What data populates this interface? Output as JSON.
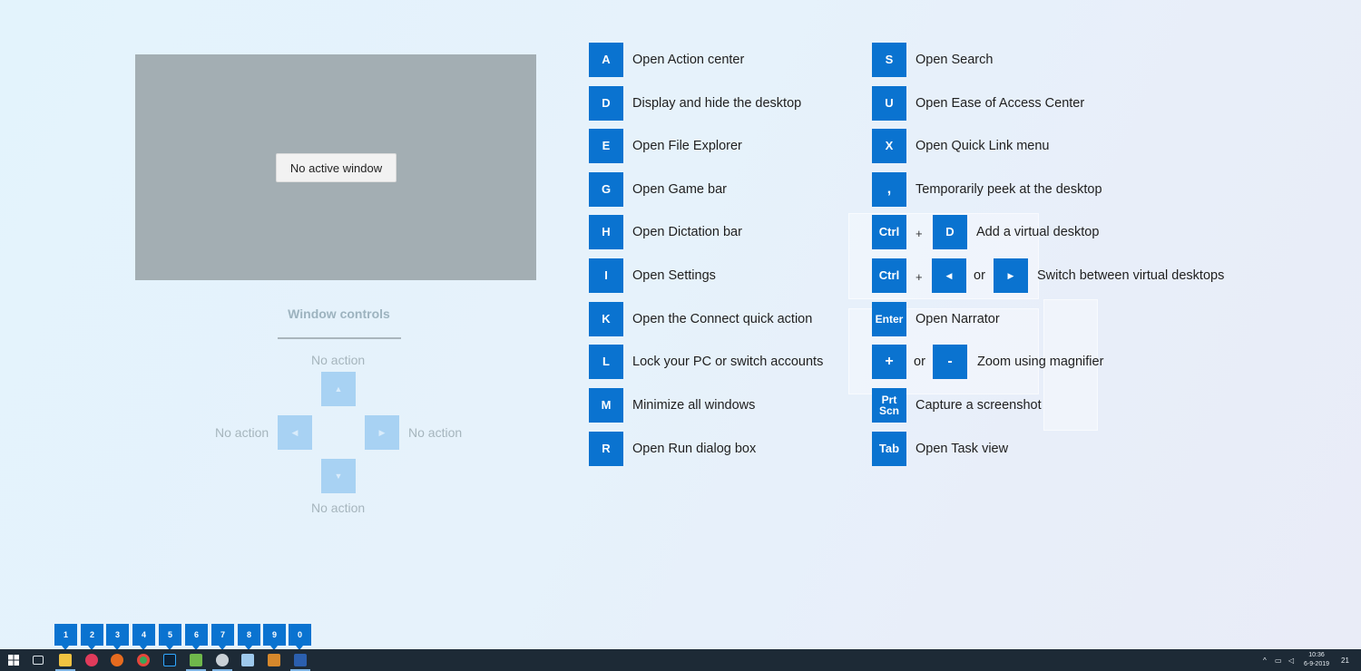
{
  "preview": {
    "no_window_label": "No active window"
  },
  "window_controls": {
    "title": "Window controls",
    "up_label": "No action",
    "left_label": "No action",
    "right_label": "No action",
    "down_label": "No action"
  },
  "shortcuts_left": [
    {
      "key": "A",
      "desc": "Open Action center"
    },
    {
      "key": "D",
      "desc": "Display and hide the desktop"
    },
    {
      "key": "E",
      "desc": "Open File Explorer"
    },
    {
      "key": "G",
      "desc": "Open Game bar"
    },
    {
      "key": "H",
      "desc": "Open Dictation bar"
    },
    {
      "key": "I",
      "desc": "Open Settings"
    },
    {
      "key": "K",
      "desc": "Open the Connect quick action"
    },
    {
      "key": "L",
      "desc": "Lock your PC or switch accounts"
    },
    {
      "key": "M",
      "desc": "Minimize all windows"
    },
    {
      "key": "R",
      "desc": "Open Run dialog box"
    }
  ],
  "shortcuts_right": {
    "s": {
      "key": "S",
      "desc": "Open Search"
    },
    "u": {
      "key": "U",
      "desc": "Open Ease of Access Center"
    },
    "x": {
      "key": "X",
      "desc": "Open Quick Link menu"
    },
    "comma": {
      "key": ",",
      "desc": "Temporarily peek at the desktop"
    },
    "ctrl_d": {
      "key1": "Ctrl",
      "plus": "+",
      "key2": "D",
      "desc": "Add a virtual desktop"
    },
    "ctrl_arrows": {
      "key1": "Ctrl",
      "plus": "+",
      "or": "or",
      "desc": "Switch between virtual desktops"
    },
    "enter": {
      "key": "Enter",
      "desc": "Open Narrator"
    },
    "zoom": {
      "key1": "+",
      "or": "or",
      "key2": "-",
      "desc": "Zoom using magnifier"
    },
    "prtscn": {
      "key_line1": "Prt",
      "key_line2": "Scn",
      "desc": "Capture a screenshot"
    },
    "tab": {
      "key": "Tab",
      "desc": "Open Task view"
    }
  },
  "badges": [
    "1",
    "2",
    "3",
    "4",
    "5",
    "6",
    "7",
    "8",
    "9",
    "0"
  ],
  "taskbar": {
    "icons": [
      "windows-start-icon",
      "task-view-icon",
      "file-explorer-icon",
      "app-red-icon",
      "firefox-icon",
      "chrome-icon",
      "photoshop-icon",
      "app-green-icon",
      "app-gray-icon",
      "app-blue-icon",
      "app-grid-icon",
      "word-icon"
    ],
    "clock_time": "10:36",
    "clock_date": "6-9-2019",
    "notification_count": "21"
  },
  "colors": {
    "key_blue": "#0a73d0",
    "arrow_blue": "#a8d2f3",
    "preview_gray": "#a3aeb3",
    "taskbar": "#1d2a36"
  }
}
